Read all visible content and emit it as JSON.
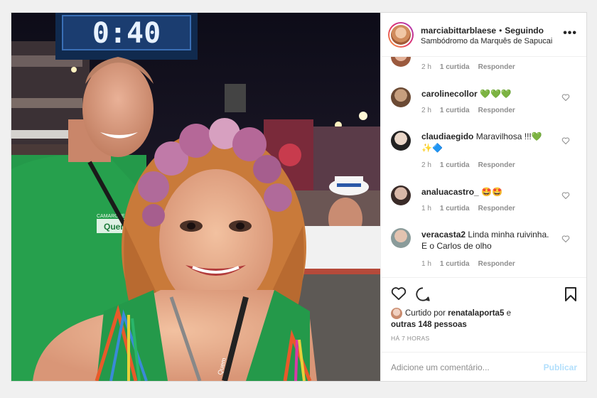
{
  "post": {
    "username": "marciabittarblaese",
    "separator": "•",
    "follow_state": "Seguindo",
    "location": "Sambódromo da Marquês de Sapucai",
    "more_icon": "more-horizontal-icon"
  },
  "photo": {
    "clock_text": "0:40",
    "shirt_text": "Quem",
    "cap_text": "CAMAROTE",
    "lanyard_text": "Quem"
  },
  "comments": [
    {
      "username": "",
      "text": "",
      "time": "2 h",
      "likes": "1 curtida",
      "reply": "Responder",
      "partial": true
    },
    {
      "username": "carolinecollor",
      "text": "💚💚💚",
      "time": "2 h",
      "likes": "1 curtida",
      "reply": "Responder"
    },
    {
      "username": "claudiaegido",
      "text": "Maravilhosa !!!💚 ✨🔷",
      "time": "2 h",
      "likes": "1 curtida",
      "reply": "Responder"
    },
    {
      "username": "analuacastro_",
      "text": "🤩🤩",
      "time": "1 h",
      "likes": "1 curtida",
      "reply": "Responder"
    },
    {
      "username": "veracasta2",
      "text": "Linda minha ruivinha. E o Carlos de olho",
      "time": "1 h",
      "likes": "1 curtida",
      "reply": "Responder"
    }
  ],
  "likes": {
    "prefix": "Curtido por",
    "user": "renatalaporta5",
    "conj": "e",
    "others": "outras 148 pessoas"
  },
  "timestamp": "HÁ 7 HORAS",
  "add_comment": {
    "placeholder": "Adicione um comentário...",
    "publish": "Publicar"
  },
  "colors": {
    "accent_blue": "#0095f6",
    "publish_disabled": "#b2dffc",
    "text": "#262626",
    "secondary_text": "#8e8e8e"
  }
}
